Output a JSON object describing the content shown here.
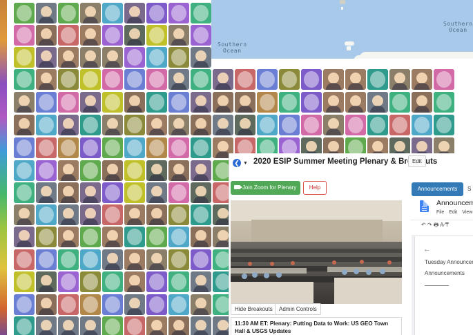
{
  "map": {
    "labels": [
      "Southern\nOcean",
      "Southern\nOcean"
    ]
  },
  "meeting": {
    "title": "2020 ESIP Summer Meeting Plenary & Breakouts",
    "edit_label": "Edit",
    "join_zoom_label": "Join Zoom for Plenary",
    "help_label": "Help",
    "hide_breakouts_label": "Hide Breakouts",
    "admin_controls_label": "Admin Controls",
    "session_title": "11:30 AM ET: Plenary: Putting Data to Work: US GEO Town Hall & USGS Updates"
  },
  "side": {
    "tab_active": "Announcements",
    "tab_next": "S",
    "doc_title": "Announceme",
    "doc_menu": [
      "File",
      "Edit",
      "View"
    ],
    "toolbar_icons": "↶ ↷ 🖶 A̷ ₸",
    "back_arrow": "←",
    "doc_heading": "Tuesday Announcer",
    "doc_subheading": "Announcements"
  },
  "icons": {
    "back": "back-circle-icon",
    "doc": "google-doc-icon",
    "camera": "video-camera-icon"
  },
  "colors": {
    "accent_blue": "#337ab7",
    "zoom_green": "#51a957",
    "help_red": "#d9534f"
  }
}
